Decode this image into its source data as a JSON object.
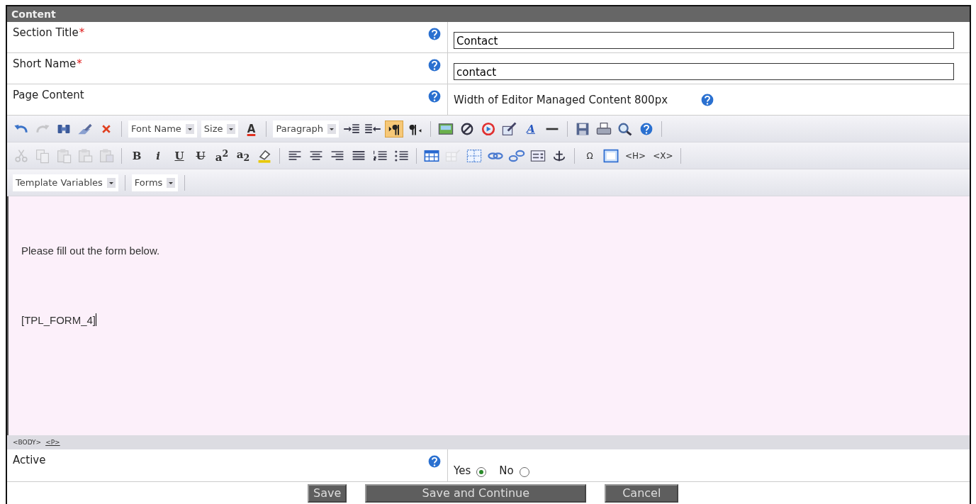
{
  "panel": {
    "title": "Content"
  },
  "fields": [
    {
      "kind": "text",
      "label": "Section Title",
      "mark": "*",
      "value": "Contact"
    },
    {
      "kind": "text",
      "label": "Short Name",
      "mark": "*",
      "value": "contact"
    },
    {
      "kind": "note",
      "label": "Page Content",
      "note": "Width of Editor Managed Content 800px"
    }
  ],
  "editor": {
    "toolbars": [
      [
        {
          "kind": "icon",
          "disabled": false,
          "on": false
        },
        {
          "kind": "icon",
          "disabled": true,
          "on": false
        },
        {
          "kind": "icon",
          "disabled": false,
          "on": false
        },
        {
          "kind": "icon",
          "disabled": false,
          "on": false
        },
        {
          "kind": "icon",
          "disabled": false,
          "on": false
        },
        {
          "kind": "separator"
        },
        {
          "kind": "dropdown",
          "label": "Font Name"
        },
        {
          "kind": "dropdown",
          "label": "Size"
        },
        {
          "kind": "glyph",
          "text": "A"
        },
        {
          "kind": "separator"
        },
        {
          "kind": "dropdown",
          "label": "Paragraph"
        },
        {
          "kind": "icon",
          "disabled": false,
          "on": false
        },
        {
          "kind": "icon",
          "disabled": false,
          "on": false
        },
        {
          "kind": "icon",
          "disabled": false,
          "on": true
        },
        {
          "kind": "icon",
          "disabled": false,
          "on": false
        },
        {
          "kind": "separator"
        },
        {
          "kind": "icon",
          "disabled": false,
          "on": false
        },
        {
          "kind": "icon",
          "disabled": false,
          "on": false
        },
        {
          "kind": "icon",
          "disabled": false,
          "on": false
        },
        {
          "kind": "icon",
          "disabled": false,
          "on": false
        },
        {
          "kind": "glyph",
          "text": "A"
        },
        {
          "kind": "icon",
          "disabled": false,
          "on": false
        },
        {
          "kind": "separator"
        },
        {
          "kind": "icon",
          "disabled": false,
          "on": false
        },
        {
          "kind": "icon",
          "disabled": false,
          "on": false
        },
        {
          "kind": "icon",
          "disabled": false,
          "on": false
        },
        {
          "kind": "icon",
          "disabled": false,
          "on": false
        },
        {
          "kind": "separator"
        }
      ],
      [
        {
          "kind": "icon",
          "disabled": true,
          "on": false
        },
        {
          "kind": "icon",
          "disabled": true,
          "on": false
        },
        {
          "kind": "icon",
          "disabled": true,
          "on": false
        },
        {
          "kind": "icon",
          "disabled": true,
          "on": false
        },
        {
          "kind": "icon",
          "disabled": true,
          "on": false
        },
        {
          "kind": "separator"
        },
        {
          "kind": "glyph",
          "text": "B"
        },
        {
          "kind": "glyph",
          "text": "i"
        },
        {
          "kind": "glyph",
          "text": "U"
        },
        {
          "kind": "glyph",
          "text": "U"
        },
        {
          "kind": "glyph",
          "text": "a$^{2}$"
        },
        {
          "kind": "glyph",
          "text": "a$_{2}$"
        },
        {
          "kind": "icon",
          "disabled": false,
          "on": false
        },
        {
          "kind": "separator"
        },
        {
          "kind": "icon",
          "disabled": false,
          "on": false
        },
        {
          "kind": "icon",
          "disabled": false,
          "on": false
        },
        {
          "kind": "icon",
          "disabled": false,
          "on": false
        },
        {
          "kind": "icon",
          "disabled": false,
          "on": false
        },
        {
          "kind": "icon",
          "disabled": false,
          "on": false
        },
        {
          "kind": "icon",
          "disabled": false,
          "on": false
        },
        {
          "kind": "separator"
        },
        {
          "kind": "icon",
          "disabled": false,
          "on": false
        },
        {
          "kind": "icon",
          "disabled": true,
          "on": false
        },
        {
          "kind": "icon",
          "disabled": false,
          "on": false
        },
        {
          "kind": "icon",
          "disabled": false,
          "on": false
        },
        {
          "kind": "icon",
          "disabled": false,
          "on": false
        },
        {
          "kind": "icon",
          "disabled": false,
          "on": false
        },
        {
          "kind": "icon",
          "disabled": false,
          "on": false
        },
        {
          "kind": "separator"
        },
        {
          "kind": "glyph",
          "text": "Ω"
        },
        {
          "kind": "icon",
          "disabled": false,
          "on": false
        },
        {
          "kind": "glyph",
          "text": "<H>"
        },
        {
          "kind": "glyph",
          "text": "<X>"
        },
        {
          "kind": "separator"
        }
      ],
      [
        {
          "kind": "dropdown",
          "label": "Template Variables"
        },
        {
          "kind": "separator"
        },
        {
          "kind": "dropdown",
          "label": "Forms"
        },
        {
          "kind": "separator"
        }
      ]
    ],
    "paragraphs": [
      "Please fill out the form below.",
      "[TPL_FORM_4]"
    ],
    "path": [
      {
        "label": "<BODY>",
        "current": false
      },
      {
        "label": "<P>",
        "current": true
      }
    ]
  },
  "active": {
    "label": "Active",
    "options": [
      {
        "label": "Yes",
        "selected": true
      },
      {
        "label": "No",
        "selected": false
      }
    ]
  },
  "buttons": [
    "Save",
    "Save and Continue",
    "Cancel"
  ]
}
